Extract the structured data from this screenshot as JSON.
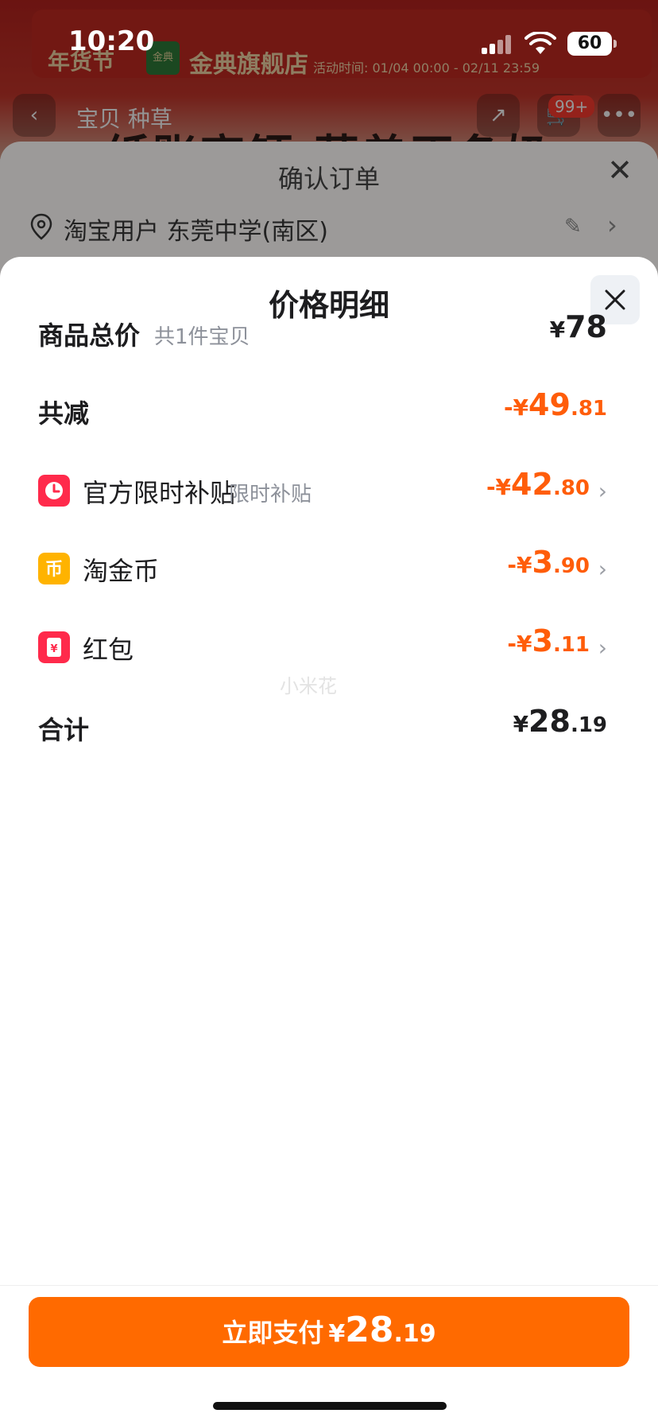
{
  "status_bar": {
    "time": "10:20",
    "battery": "60"
  },
  "background": {
    "banner_brand": "年货节",
    "banner_logo": "金典",
    "banner_store": "金典旗舰店",
    "banner_time": "活动时间: 01/04 00:00 - 02/11 23:59",
    "nav_tabs": "宝贝  种草",
    "cart_badge": "99+",
    "product_title": "纸账高钙 蓝盖正条奶",
    "back_icon": "chevron-left-icon",
    "share_icon": "share-icon",
    "cart_icon": "cart-icon",
    "more_icon": "more-icon"
  },
  "order_sheet": {
    "title": "确认订单",
    "address": "淘宝用户 东莞中学(南区)"
  },
  "price_detail": {
    "title": "价格明细",
    "rows": [
      {
        "label": "商品总价",
        "sub": "共1件宝贝",
        "currency": "¥",
        "int": "78",
        "dec": ""
      },
      {
        "label": "共减",
        "currency": "-¥",
        "int": "49",
        "dec": ".81"
      },
      {
        "label": "官方限时补贴",
        "sub": "限时补贴",
        "currency": "-¥",
        "int": "42",
        "dec": ".80",
        "icon": "clock-icon"
      },
      {
        "label": "淘金币",
        "currency": "-¥",
        "int": "3",
        "dec": ".90",
        "icon": "coin-icon"
      },
      {
        "label": "红包",
        "currency": "-¥",
        "int": "3",
        "dec": ".11",
        "icon": "red-packet-icon"
      },
      {
        "label": "合计",
        "currency": "¥",
        "int": "28",
        "dec": ".19"
      }
    ],
    "watermark": "小米花"
  },
  "pay_button": {
    "label": "立即支付",
    "currency": "¥",
    "int": "28",
    "dec": ".19"
  },
  "colors": {
    "accent": "#ff6a00",
    "discount": "#ff5d0a",
    "clock_icon": "#ff2a4b",
    "coin_icon": "#ffb300",
    "red_packet_icon": "#ff2a4b"
  }
}
